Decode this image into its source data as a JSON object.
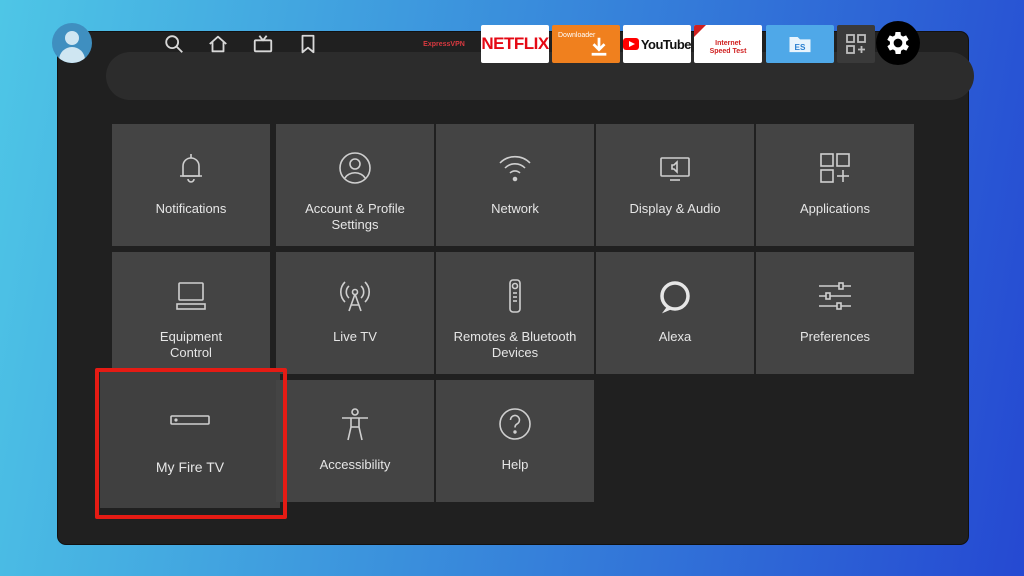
{
  "nav": {
    "items": [
      "profile",
      "search",
      "home",
      "live",
      "watchlist"
    ]
  },
  "apps": [
    {
      "label": "ExpressVPN",
      "bg": "#f6f6f6",
      "fg": "#da3940"
    },
    {
      "label": "NETFLIX",
      "bg": "#ffffff",
      "fg": "#e50914"
    },
    {
      "label": "Downloader",
      "bg": "#f0801e",
      "fg": "#ffffff"
    },
    {
      "label": "YouTube",
      "bg": "#ffffff",
      "fg": "#111111"
    },
    {
      "label": "Internet Speed Test",
      "bg": "#ffffff",
      "fg": "#d02020"
    },
    {
      "label": "ES",
      "bg": "#4fa8e8",
      "fg": "#ffffff"
    }
  ],
  "settings": {
    "tiles": [
      {
        "label": "Notifications",
        "icon": "bell-icon"
      },
      {
        "label": "Account & Profile\nSettings",
        "icon": "profile-icon"
      },
      {
        "label": "Network",
        "icon": "wifi-icon"
      },
      {
        "label": "Display & Audio",
        "icon": "display-icon"
      },
      {
        "label": "Applications",
        "icon": "apps-icon"
      },
      {
        "label": "Equipment\nControl",
        "icon": "monitor-icon"
      },
      {
        "label": "Live TV",
        "icon": "antenna-icon"
      },
      {
        "label": "Remotes & Bluetooth\nDevices",
        "icon": "remote-icon"
      },
      {
        "label": "Alexa",
        "icon": "alexa-icon"
      },
      {
        "label": "Preferences",
        "icon": "sliders-icon"
      },
      {
        "label": "My Fire TV",
        "icon": "firetv-device-icon"
      },
      {
        "label": "Accessibility",
        "icon": "accessibility-icon"
      },
      {
        "label": "Help",
        "icon": "help-icon"
      }
    ],
    "focused_label": "My Fire TV"
  },
  "colors": {
    "highlight": "#e51b14",
    "tile_bg": "#444444",
    "screen_bg": "#202020"
  }
}
